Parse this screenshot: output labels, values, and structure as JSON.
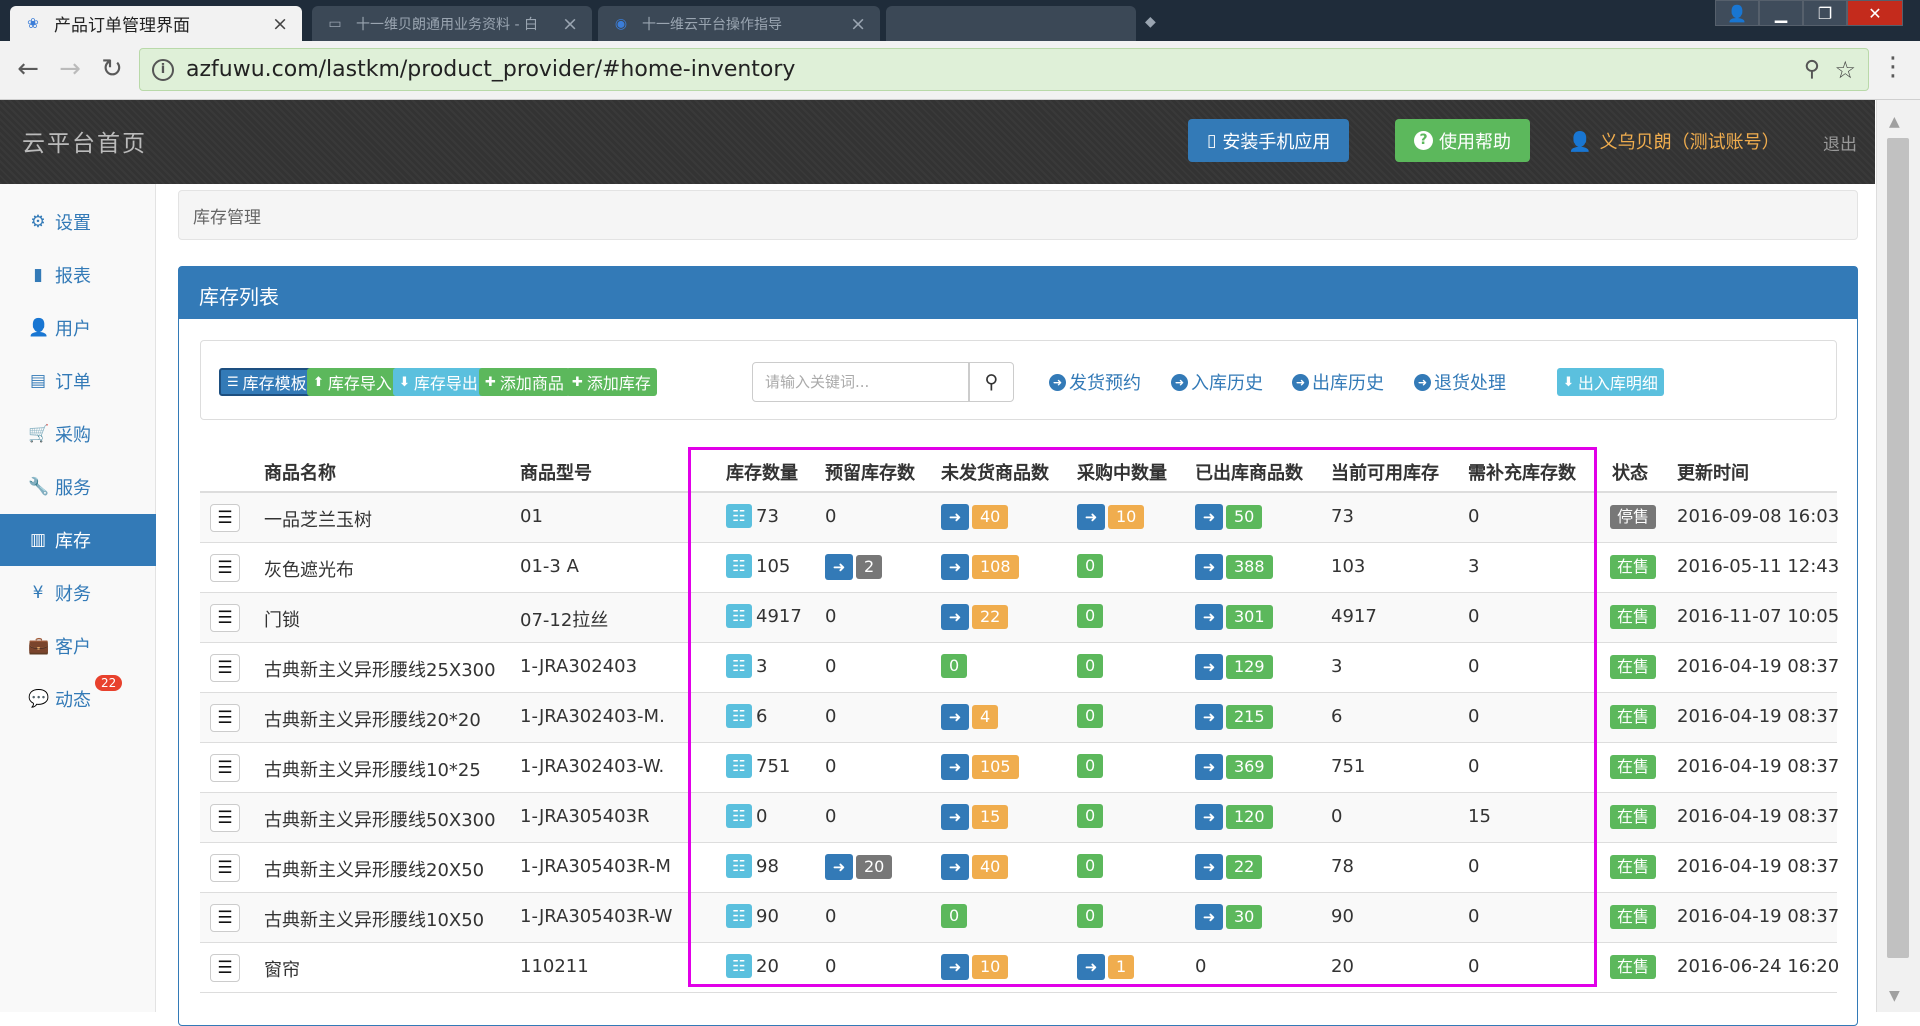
{
  "browser": {
    "active_tab": "产品订单管理界面",
    "inactive_tabs": [
      "十一维贝朗通用业务资料 - 白",
      "十一维云平台操作指导"
    ],
    "url": "azfuwu.com/lastkm/product_provider/#home-inventory"
  },
  "header": {
    "brand": "云平台首页",
    "install_app": "安装手机应用",
    "help": "使用帮助",
    "user": "义乌贝朗（测试账号）",
    "logout": "退出"
  },
  "sidebar": {
    "items": [
      {
        "label": "设置",
        "icon": "gear-icon"
      },
      {
        "label": "报表",
        "icon": "bar-chart-icon"
      },
      {
        "label": "用户",
        "icon": "user-icon"
      },
      {
        "label": "订单",
        "icon": "list-icon"
      },
      {
        "label": "采购",
        "icon": "cart-icon"
      },
      {
        "label": "服务",
        "icon": "wrench-icon"
      },
      {
        "label": "库存",
        "icon": "barcode-icon"
      },
      {
        "label": "财务",
        "icon": "yen-icon"
      },
      {
        "label": "客户",
        "icon": "briefcase-icon"
      },
      {
        "label": "动态",
        "icon": "comment-icon",
        "badge": "22"
      }
    ],
    "active_index": 6
  },
  "breadcrumb": "库存管理",
  "panel": {
    "title": "库存列表",
    "toolbar": {
      "template": "库存模板",
      "import": "库存导入",
      "export": "库存导出",
      "add_product": "添加商品",
      "add_stock": "添加库存",
      "search_placeholder": "请输入关键词...",
      "links": [
        "发货预约",
        "入库历史",
        "出库历史",
        "退货处理"
      ],
      "detail": "出入库明细"
    },
    "columns": [
      "商品名称",
      "商品型号",
      "库存数量",
      "预留库存数",
      "未发货商品数",
      "采购中数量",
      "已出库商品数",
      "当前可用库存",
      "需补充库存数",
      "状态",
      "更新时间"
    ],
    "rows": [
      {
        "name": "一品芝兰玉树",
        "model": "01",
        "stock": "73",
        "reserved": "0",
        "reserved_badge": "",
        "unshipped": "40",
        "purchasing": "10",
        "shipped": "50",
        "available": "73",
        "replenish": "0",
        "status": "停售",
        "updated": "2016-09-08 16:03"
      },
      {
        "name": "灰色遮光布",
        "model": "01-3 A",
        "stock": "105",
        "reserved": "",
        "reserved_badge": "2",
        "unshipped": "108",
        "purchasing": "0",
        "shipped": "388",
        "available": "103",
        "replenish": "3",
        "status": "在售",
        "updated": "2016-05-11 12:43"
      },
      {
        "name": "门锁",
        "model": "07-12拉丝",
        "stock": "4917",
        "reserved": "0",
        "reserved_badge": "",
        "unshipped": "22",
        "purchasing": "0",
        "shipped": "301",
        "available": "4917",
        "replenish": "0",
        "status": "在售",
        "updated": "2016-11-07 10:05"
      },
      {
        "name": "古典新主义异形腰线25X300",
        "model": "1-JRA302403",
        "stock": "3",
        "reserved": "0",
        "reserved_badge": "",
        "unshipped": "0",
        "purchasing": "0",
        "shipped": "129",
        "available": "3",
        "replenish": "0",
        "status": "在售",
        "updated": "2016-04-19 08:37"
      },
      {
        "name": "古典新主义异形腰线20*20",
        "model": "1-JRA302403-M.",
        "stock": "6",
        "reserved": "0",
        "reserved_badge": "",
        "unshipped": "4",
        "purchasing": "0",
        "shipped": "215",
        "available": "6",
        "replenish": "0",
        "status": "在售",
        "updated": "2016-04-19 08:37"
      },
      {
        "name": "古典新主义异形腰线10*25",
        "model": "1-JRA302403-W.",
        "stock": "751",
        "reserved": "0",
        "reserved_badge": "",
        "unshipped": "105",
        "purchasing": "0",
        "shipped": "369",
        "available": "751",
        "replenish": "0",
        "status": "在售",
        "updated": "2016-04-19 08:37"
      },
      {
        "name": "古典新主义异形腰线50X300",
        "model": "1-JRA305403R",
        "stock": "0",
        "reserved": "0",
        "reserved_badge": "",
        "unshipped": "15",
        "purchasing": "0",
        "shipped": "120",
        "available": "0",
        "replenish": "15",
        "status": "在售",
        "updated": "2016-04-19 08:37"
      },
      {
        "name": "古典新主义异形腰线20X50",
        "model": "1-JRA305403R-M",
        "stock": "98",
        "reserved": "",
        "reserved_badge": "20",
        "unshipped": "40",
        "purchasing": "0",
        "shipped": "22",
        "available": "78",
        "replenish": "0",
        "status": "在售",
        "updated": "2016-04-19 08:37"
      },
      {
        "name": "古典新主义异形腰线10X50",
        "model": "1-JRA305403R-W",
        "stock": "90",
        "reserved": "0",
        "reserved_badge": "",
        "unshipped": "0",
        "purchasing": "0",
        "shipped": "30",
        "available": "90",
        "replenish": "0",
        "status": "在售",
        "updated": "2016-04-19 08:37"
      },
      {
        "name": "窗帘",
        "model": "110211",
        "stock": "20",
        "reserved": "0",
        "reserved_badge": "",
        "unshipped": "10",
        "purchasing": "1",
        "shipped": "0",
        "available": "20",
        "replenish": "0",
        "status": "在售",
        "updated": "2016-06-24 16:20"
      }
    ]
  },
  "colors": {
    "primary": "#337ab7",
    "success": "#5cb85c",
    "warning": "#f0ad4e",
    "info": "#5bc0de",
    "highlight": "#e100e8"
  }
}
